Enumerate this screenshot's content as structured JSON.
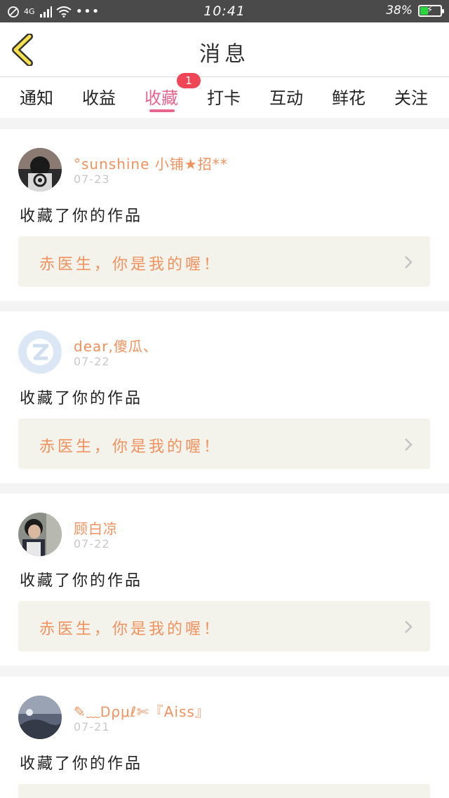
{
  "status_bar": {
    "network": "4G",
    "time": "10:41",
    "battery": "38%",
    "battery_level": 0.38
  },
  "header": {
    "title": "消息"
  },
  "tabs": [
    {
      "label": "通知"
    },
    {
      "label": "收益"
    },
    {
      "label": "收藏",
      "active": true,
      "badge": "1"
    },
    {
      "label": "打卡"
    },
    {
      "label": "互动"
    },
    {
      "label": "鲜花"
    },
    {
      "label": "关注"
    }
  ],
  "notifications": [
    {
      "username": "°sunshine 小铺★招**",
      "date": "07-23",
      "action": "收藏了你的作品",
      "work_title": "赤医生，你是我的喔！"
    },
    {
      "username": "dear,傻瓜、",
      "date": "07-22",
      "action": "收藏了你的作品",
      "work_title": "赤医生，你是我的喔！"
    },
    {
      "username": "顾白凉",
      "date": "07-22",
      "action": "收藏了你的作品",
      "work_title": "赤医生，你是我的喔！"
    },
    {
      "username": "✎﹏Ꭰρμℓ✄『Aiss』",
      "date": "07-21",
      "action": "收藏了你的作品"
    }
  ],
  "colors": {
    "accent": "#e8658f",
    "name": "#f2915d",
    "badge": "#f04656"
  }
}
